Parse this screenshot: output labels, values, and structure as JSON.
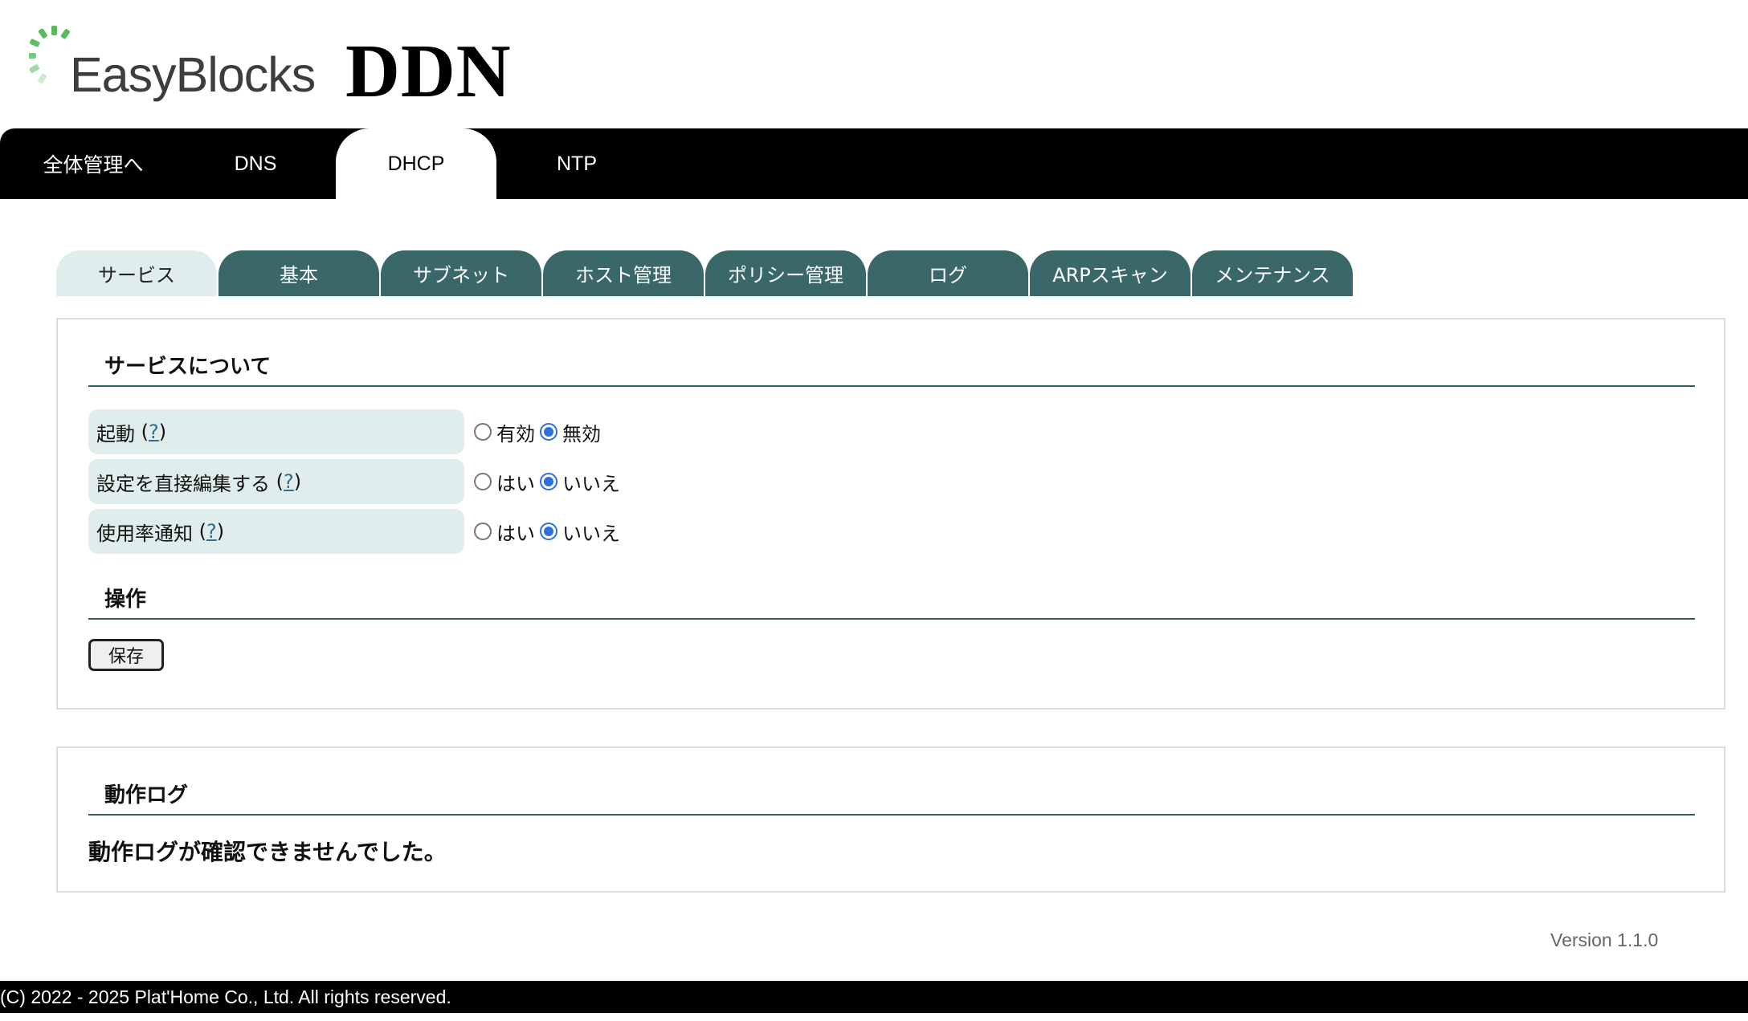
{
  "header": {
    "logo_text": "EasyBlocks",
    "product_title": "DDN"
  },
  "topnav": {
    "items": [
      {
        "label": "全体管理へ",
        "active": false
      },
      {
        "label": "DNS",
        "active": false
      },
      {
        "label": "DHCP",
        "active": true
      },
      {
        "label": "NTP",
        "active": false
      }
    ]
  },
  "subtabs": [
    {
      "label": "サービス",
      "active": true
    },
    {
      "label": "基本",
      "active": false
    },
    {
      "label": "サブネット",
      "active": false
    },
    {
      "label": "ホスト管理",
      "active": false
    },
    {
      "label": "ポリシー管理",
      "active": false
    },
    {
      "label": "ログ",
      "active": false
    },
    {
      "label": "ARPスキャン",
      "active": false
    },
    {
      "label": "メンテナンス",
      "active": false
    }
  ],
  "service_section": {
    "heading": "サービスについて",
    "settings": [
      {
        "label": "起動",
        "help": "?",
        "options": [
          "有効",
          "無効"
        ],
        "selected": "無効"
      },
      {
        "label": "設定を直接編集する",
        "help": "?",
        "options": [
          "はい",
          "いいえ"
        ],
        "selected": "いいえ"
      },
      {
        "label": "使用率通知",
        "help": "?",
        "options": [
          "はい",
          "いいえ"
        ],
        "selected": "いいえ"
      }
    ]
  },
  "operations_section": {
    "heading": "操作",
    "save_label": "保存"
  },
  "log_section": {
    "heading": "動作ログ",
    "message": "動作ログが確認できませんでした。"
  },
  "version": "Version 1.1.0",
  "footer": {
    "copyright": "(C) 2022 - 2025 Plat'Home Co., Ltd. All rights reserved."
  },
  "colors": {
    "tab_background": "#3a6868",
    "tab_active_background": "#dfedec",
    "heading_rule": "#2e5f5f",
    "radio_checked": "#2f6fdc",
    "logo_green": "#5cb85c"
  }
}
